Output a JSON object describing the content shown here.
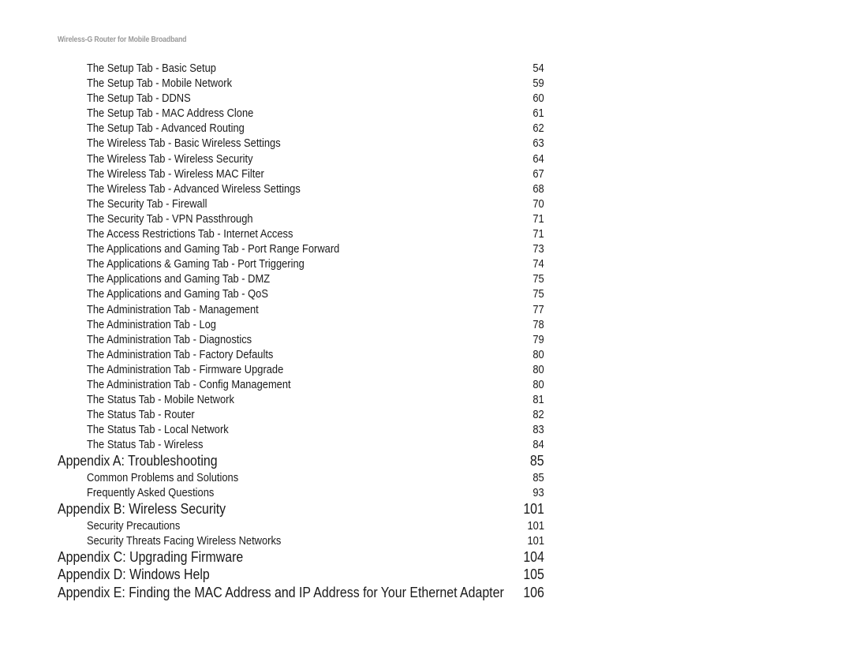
{
  "running_header": "Wireless-G Router for Mobile Broadband",
  "toc": [
    {
      "level": 2,
      "title": "The Setup Tab - Basic Setup",
      "page": "54"
    },
    {
      "level": 2,
      "title": "The Setup Tab - Mobile Network",
      "page": "59"
    },
    {
      "level": 2,
      "title": "The Setup Tab - DDNS",
      "page": "60"
    },
    {
      "level": 2,
      "title": "The Setup Tab - MAC Address Clone",
      "page": "61"
    },
    {
      "level": 2,
      "title": "The Setup Tab - Advanced Routing",
      "page": "62"
    },
    {
      "level": 2,
      "title": "The Wireless Tab - Basic Wireless Settings",
      "page": "63"
    },
    {
      "level": 2,
      "title": "The Wireless Tab - Wireless Security",
      "page": "64"
    },
    {
      "level": 2,
      "title": "The Wireless Tab - Wireless MAC Filter",
      "page": "67"
    },
    {
      "level": 2,
      "title": "The Wireless Tab - Advanced Wireless Settings",
      "page": "68"
    },
    {
      "level": 2,
      "title": "The Security Tab - Firewall",
      "page": "70"
    },
    {
      "level": 2,
      "title": "The Security Tab - VPN Passthrough",
      "page": "71"
    },
    {
      "level": 2,
      "title": "The Access Restrictions Tab - Internet Access",
      "page": "71"
    },
    {
      "level": 2,
      "title": "The Applications and Gaming Tab - Port Range Forward",
      "page": "73"
    },
    {
      "level": 2,
      "title": "The Applications & Gaming Tab - Port Triggering",
      "page": "74"
    },
    {
      "level": 2,
      "title": "The Applications and Gaming Tab - DMZ",
      "page": "75"
    },
    {
      "level": 2,
      "title": "The Applications and Gaming Tab - QoS",
      "page": "75"
    },
    {
      "level": 2,
      "title": "The Administration Tab - Management",
      "page": "77"
    },
    {
      "level": 2,
      "title": "The Administration Tab - Log",
      "page": "78"
    },
    {
      "level": 2,
      "title": "The Administration Tab - Diagnostics",
      "page": "79"
    },
    {
      "level": 2,
      "title": "The Administration Tab - Factory Defaults",
      "page": "80"
    },
    {
      "level": 2,
      "title": "The Administration Tab - Firmware Upgrade",
      "page": "80"
    },
    {
      "level": 2,
      "title": "The Administration Tab - Config Management",
      "page": "80"
    },
    {
      "level": 2,
      "title": "The Status Tab - Mobile Network",
      "page": "81"
    },
    {
      "level": 2,
      "title": "The Status Tab - Router",
      "page": "82"
    },
    {
      "level": 2,
      "title": "The Status Tab - Local Network",
      "page": "83"
    },
    {
      "level": 2,
      "title": "The Status Tab - Wireless",
      "page": "84"
    },
    {
      "level": 1,
      "title": "Appendix A: Troubleshooting",
      "page": "85"
    },
    {
      "level": 2,
      "title": "Common Problems and Solutions",
      "page": "85"
    },
    {
      "level": 2,
      "title": "Frequently Asked Questions",
      "page": "93"
    },
    {
      "level": 1,
      "title": "Appendix B: Wireless Security",
      "page": "101"
    },
    {
      "level": 2,
      "title": "Security Precautions",
      "page": "101"
    },
    {
      "level": 2,
      "title": "Security Threats Facing Wireless Networks",
      "page": "101"
    },
    {
      "level": 1,
      "title": "Appendix C: Upgrading Firmware",
      "page": "104"
    },
    {
      "level": 1,
      "title": "Appendix D: Windows Help",
      "page": "105"
    },
    {
      "level": 1,
      "title": "Appendix E: Finding the MAC Address and IP Address for Your Ethernet Adapter",
      "page": "106"
    }
  ]
}
